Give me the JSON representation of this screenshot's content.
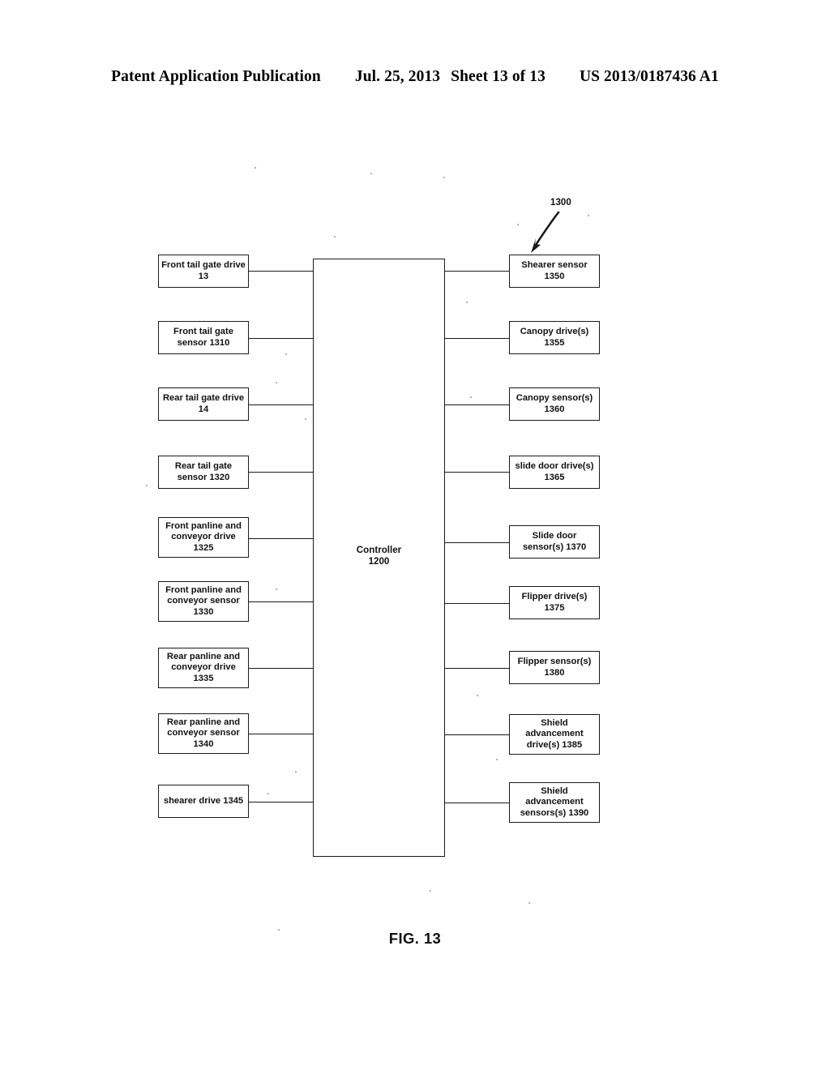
{
  "header": {
    "publication": "Patent Application Publication",
    "date": "Jul. 25, 2013",
    "sheet": "Sheet 13 of 13",
    "patent_number": "US 2013/0187436 A1"
  },
  "figure": {
    "caption": "FIG. 13",
    "reference_numeral": "1300",
    "controller": {
      "label": "Controller\n1200"
    },
    "left_blocks": [
      {
        "label": "Front tail gate drive\n13"
      },
      {
        "label": "Front tail gate\nsensor 1310"
      },
      {
        "label": "Rear tail gate drive\n14"
      },
      {
        "label": "Rear tail gate\nsensor 1320"
      },
      {
        "label": "Front panline and\nconveyor drive\n1325"
      },
      {
        "label": "Front panline and\nconveyor sensor\n1330"
      },
      {
        "label": "Rear panline and\nconveyor drive\n1335"
      },
      {
        "label": "Rear panline and\nconveyor sensor\n1340"
      },
      {
        "label": "shearer drive 1345"
      }
    ],
    "right_blocks": [
      {
        "label": "Shearer sensor\n1350"
      },
      {
        "label": "Canopy drive(s)\n1355"
      },
      {
        "label": "Canopy sensor(s)\n1360"
      },
      {
        "label": "slide door drive(s)\n1365"
      },
      {
        "label": "Slide door\nsensor(s) 1370"
      },
      {
        "label": "Flipper drive(s)\n1375"
      },
      {
        "label": "Flipper sensor(s)\n1380"
      },
      {
        "label": "Shield\nadvancement\ndrive(s) 1385"
      },
      {
        "label": "Shield\nadvancement\nsensors(s) 1390"
      }
    ]
  },
  "colors": {
    "ink": "#111111",
    "paper": "#ffffff"
  }
}
